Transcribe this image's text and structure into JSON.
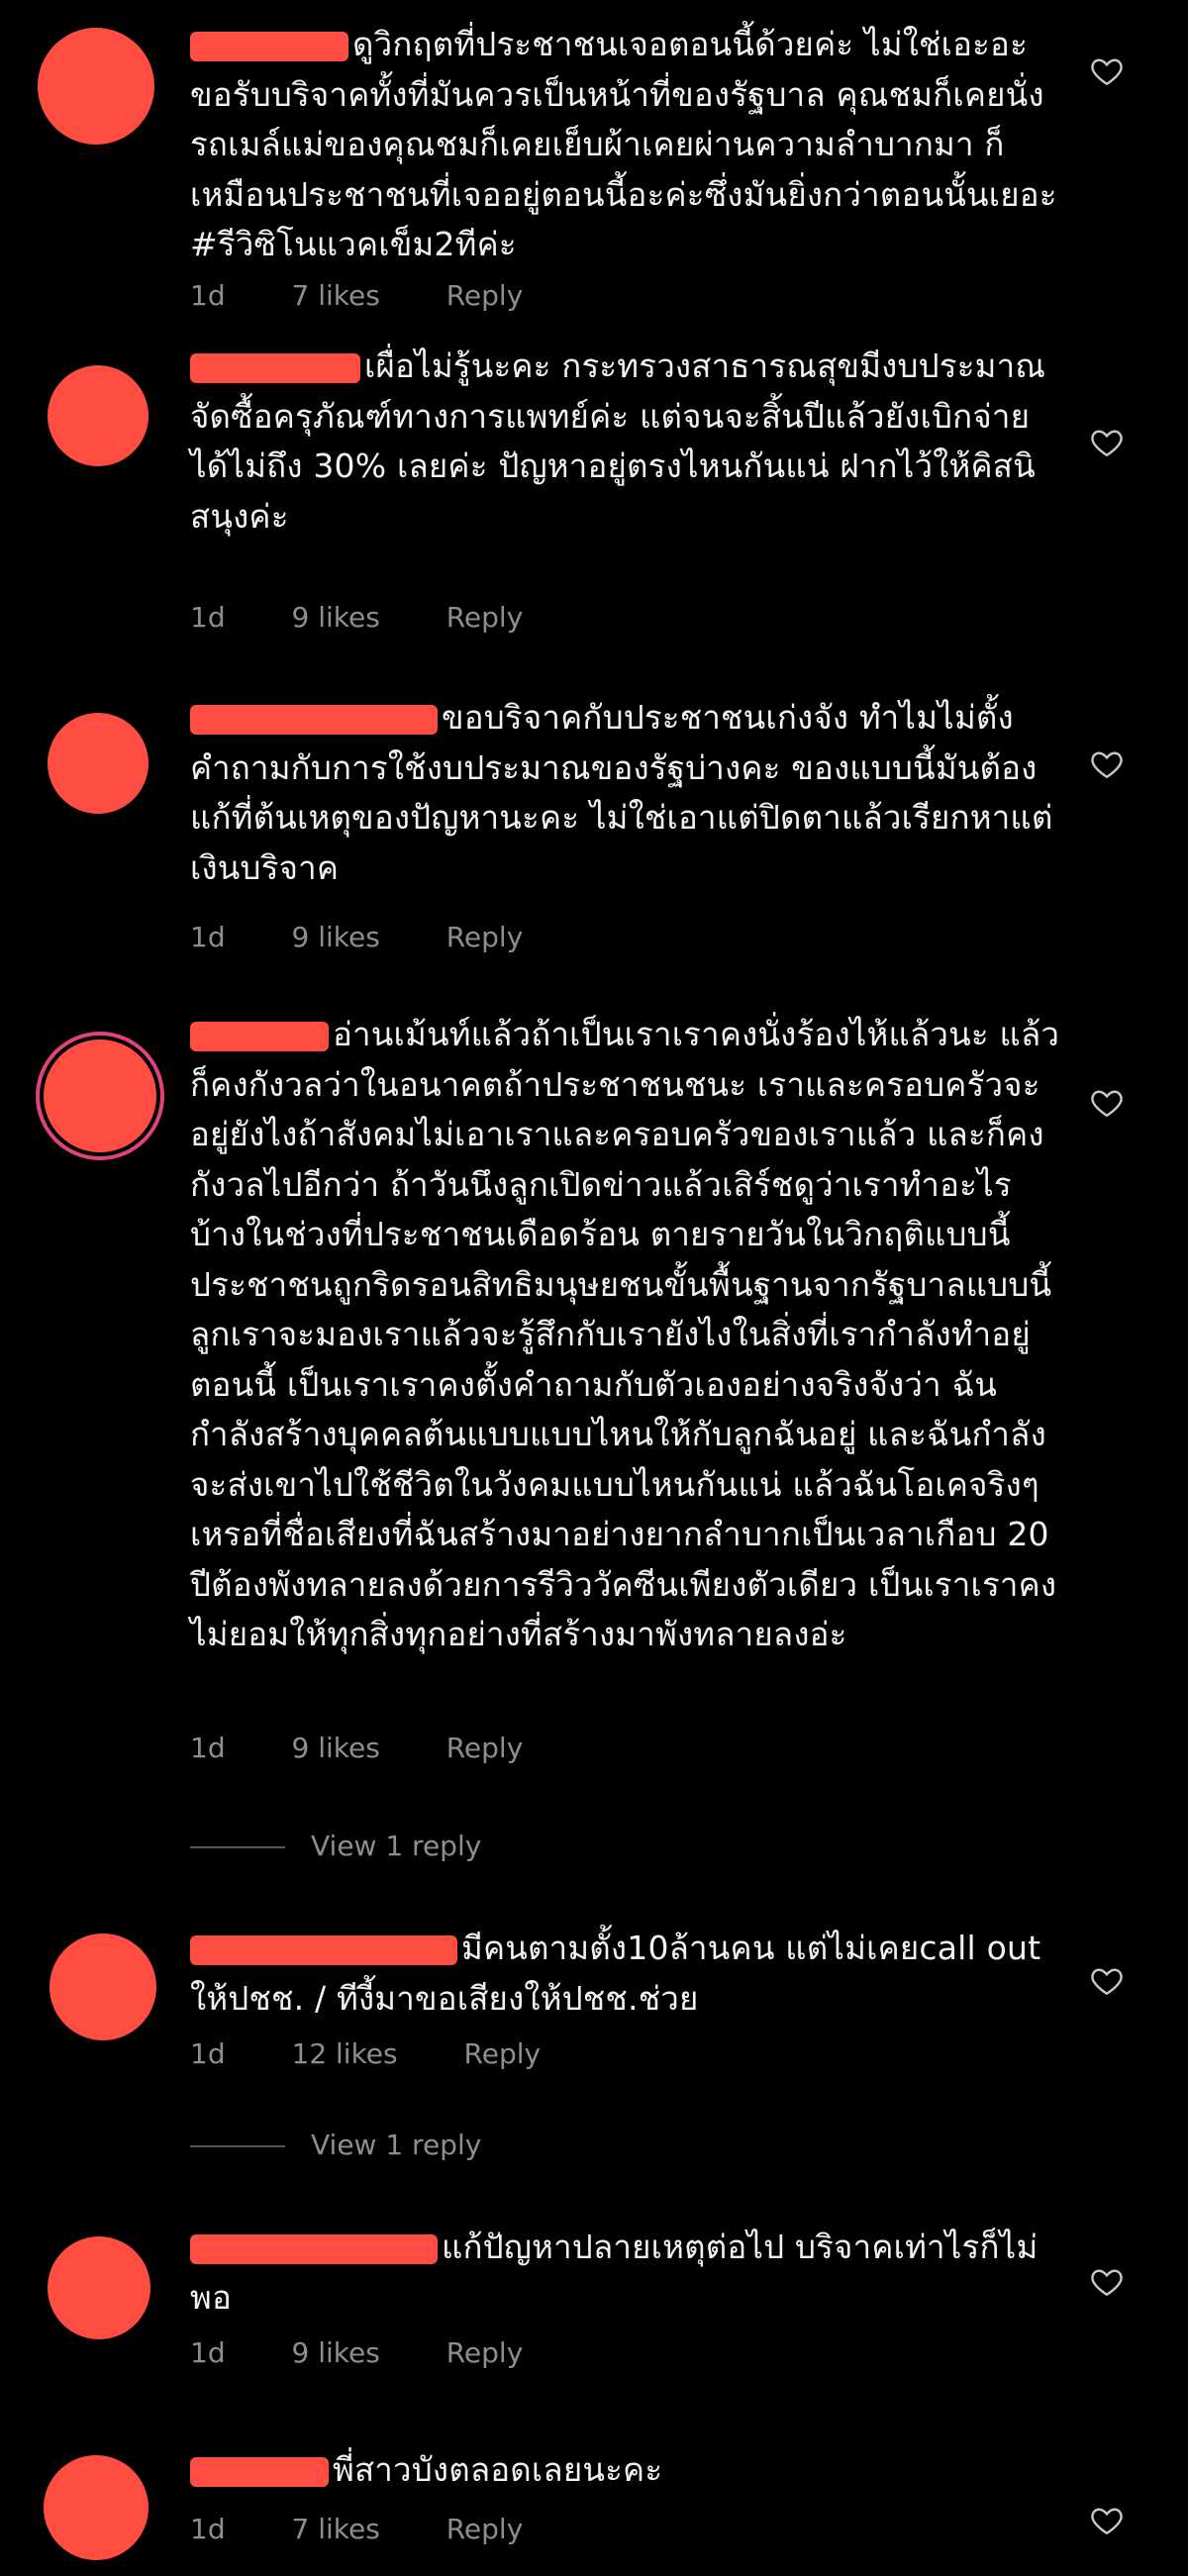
{
  "comments": [
    {
      "text": "ดูวิกฤตที่ประชาชนเจอตอนนี้ด้วยค่ะ ไม่ใช่เอะอะขอรับบริจาคทั้งที่มันควรเป็นหน้าที่ของรัฐบาล คุณชมก็เคยนั่งรถเมล์แม่ของคุณชมก็เคยเย็บผ้าเคยผ่านความลำบากมา ก็เหมือนประชาชนที่เจออยู่ตอนนี้อะค่ะซึ่งมันยิ่งกว่าตอนนั้นเยอะ #รีวิซิโนแวคเข็ม2ทีค่ะ",
      "time": "1d",
      "likes": "7 likes",
      "reply": "Reply"
    },
    {
      "text": "เผื่อไม่รู้นะคะ กระทรวงสาธารณสุขมีงบประมาณจัดซื้อครุภัณฑ์ทางการแพทย์ค่ะ แต่จนจะสิ้นปีแล้วยังเบิกจ่ายได้ไม่ถึง 30% เลยค่ะ ปัญหาอยู่ตรงไหนกันแน่ ฝากไว้ให้คิสนิสนุงค่ะ",
      "time": "1d",
      "likes": "9 likes",
      "reply": "Reply"
    },
    {
      "text": "ขอบริจาคกับประชาชนเก่งจัง ทำไมไม่ตั้งคำถามกับการใช้งบประมาณของรัฐบ่างคะ ของแบบนี้มันต้องแก้ที่ต้นเหตุของปัญหานะคะ ไม่ใช่เอาแต่ปิดตาแล้วเรียกหาแต่เงินบริจาค",
      "time": "1d",
      "likes": "9 likes",
      "reply": "Reply"
    },
    {
      "text": "อ่านเม้นท์แล้วถ้าเป็นเราเราคงนั่งร้องไห้แล้วนะ แล้วก็คงกังวลว่าในอนาคตถ้าประชาชนชนะ เราและครอบครัวจะอยู่ยังไงถ้าสังคมไม่เอาเราและครอบครัวของเราแล้ว และก็คงกังวลไปอีกว่า ถ้าวันนึงลูกเปิดข่าวแล้วเสิร์ชดูว่าเราทำอะไรบ้างในช่วงที่ประชาชนเดือดร้อน ตายรายวันในวิกฤติแบบนี้ ประชาชนถูกริดรอนสิทธิมนุษยชนขั้นพื้นฐานจากรัฐบาลแบบนี้ ลูกเราจะมองเราแล้วจะรู้สึกกับเรายังไงในสิ่งที่เรากำลังทำอยู่ตอนนี้ เป็นเราเราคงตั้งคำถามกับตัวเองอย่างจริงจังว่า ฉันกำลังสร้างบุคคลต้นแบบแบบไหนให้กับลูกฉันอยู่ และฉันกำลังจะส่งเขาไปใช้ชีวิตในวังคมแบบไหนกันแน่ แล้วฉันโอเคจริงๆ เหรอที่ชื่อเสียงที่ฉันสร้างมาอย่างยากลำบากเป็นเวลาเกือบ 20 ปีต้องพังทลายลงด้วยการรีวิววัคซีนเพียงตัวเดียว เป็นเราเราคงไม่ยอมให้ทุกสิ่งทุกอย่างที่สร้างมาพังทลายลงอ่ะ",
      "time": "1d",
      "likes": "9 likes",
      "reply": "Reply"
    },
    {
      "text": "มีคนตามตั้ง10ล้านคน แต่ไม่เคยcall out ให้ปชช. / ทีงี้มาขอเสียงให้ปชช.ช่วย",
      "time": "1d",
      "likes": "12 likes",
      "reply": "Reply"
    },
    {
      "text": "แก้ปัญหาปลายเหตุต่อไป บริจาคเท่าไรก็ไม่พอ",
      "time": "1d",
      "likes": "9 likes",
      "reply": "Reply"
    },
    {
      "text": "พี่สาวบังตลอดเลยนะคะ",
      "time": "1d",
      "likes": "7 likes",
      "reply": "Reply"
    }
  ],
  "view_replies": [
    "View 1 reply",
    "View 1 reply"
  ],
  "colors": {
    "background": "#000000",
    "text": "#f2f2f2",
    "meta": "#8e8e8e",
    "redaction": "#ff4d42"
  }
}
